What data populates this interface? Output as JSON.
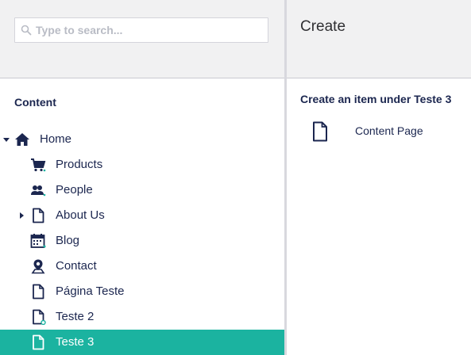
{
  "search": {
    "placeholder": "Type to search...",
    "value": ""
  },
  "tree": {
    "section_title": "Content",
    "items": [
      {
        "label": "Home",
        "icon": "home-icon"
      },
      {
        "label": "Products",
        "icon": "shopping-cart-icon"
      },
      {
        "label": "People",
        "icon": "people-icon"
      },
      {
        "label": "About Us",
        "icon": "document-icon"
      },
      {
        "label": "Blog",
        "icon": "calendar-icon"
      },
      {
        "label": "Contact",
        "icon": "map-pin-icon"
      },
      {
        "label": "Página Teste",
        "icon": "document-icon"
      },
      {
        "label": "Teste 2",
        "icon": "document-icon"
      },
      {
        "label": "Teste 3",
        "icon": "document-icon",
        "selected": true
      }
    ]
  },
  "create_panel": {
    "title": "Create",
    "heading": "Create an item under Teste 3",
    "doc_types": [
      {
        "label": "Content Page",
        "icon": "document-icon"
      }
    ]
  },
  "colors": {
    "selected_bg": "#1bb3a0",
    "text": "#1b264f",
    "header_bg": "#f1f1f2"
  }
}
